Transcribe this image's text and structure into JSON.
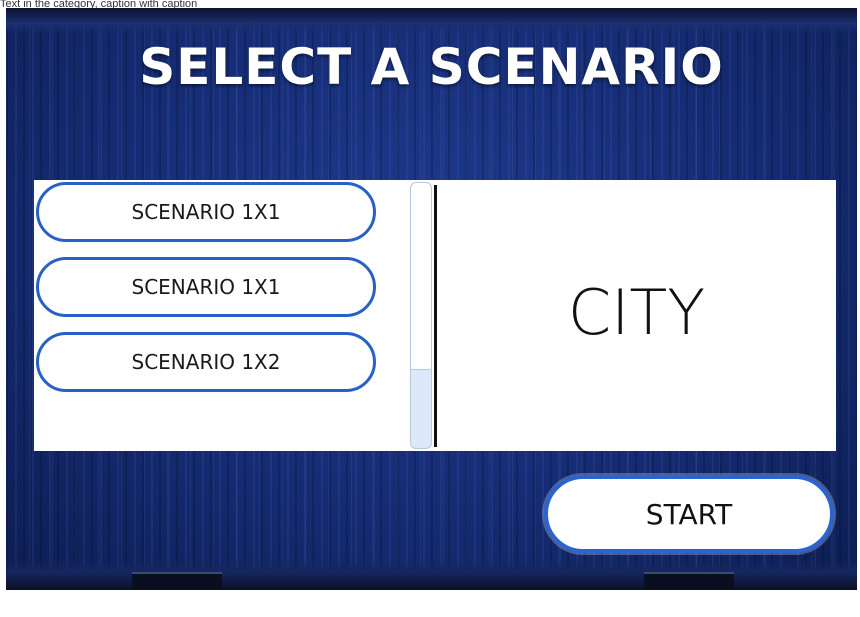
{
  "caption": "Text in the category, caption with caption",
  "screen": {
    "title": "SELECT A SCENARIO",
    "scenarios": [
      {
        "label": "SCENARIO 1X1"
      },
      {
        "label": "SCENARIO 1X1"
      },
      {
        "label": "SCENARIO 1X2"
      }
    ],
    "preview": {
      "label": "CITY"
    },
    "start_label": "START"
  },
  "colors": {
    "background": "#152c74",
    "button_border": "#2760c8",
    "panel": "#ffffff",
    "text": "#111111"
  }
}
